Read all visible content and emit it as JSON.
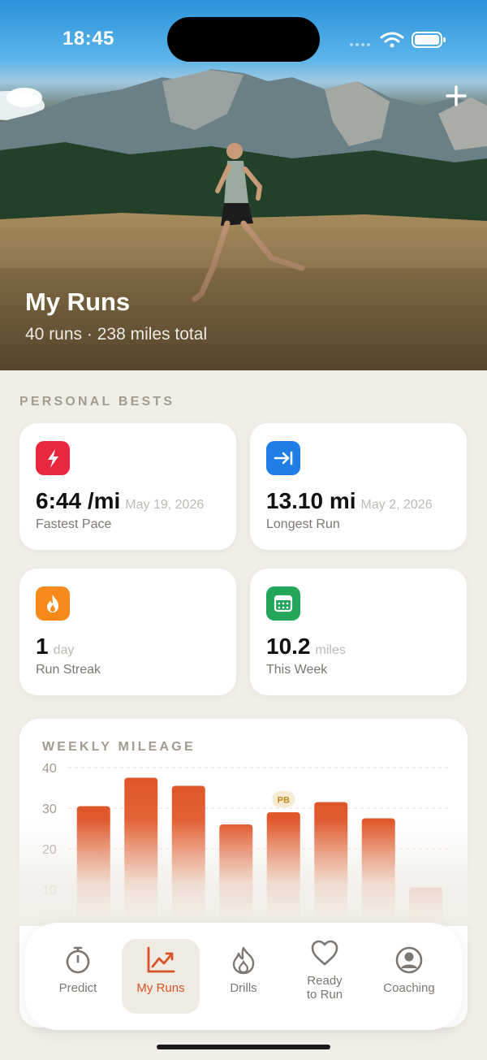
{
  "status_bar": {
    "time": "18:45"
  },
  "hero": {
    "title": "My Runs",
    "subtitle": "40 runs · 238 miles total",
    "add_icon": "plus-icon"
  },
  "personal_bests": {
    "label": "PERSONAL BESTS",
    "cards": [
      {
        "value": "6:44 /mi",
        "aux": "May 19, 2026",
        "label": "Fastest Pace",
        "icon": "lightning-bolt-icon",
        "color": "#E8283F"
      },
      {
        "value": "13.10 mi",
        "aux": "May 2, 2026",
        "label": "Longest Run",
        "icon": "arrow-right-to-line-icon",
        "color": "#1F7EE6"
      },
      {
        "value": "1",
        "aux": "day",
        "label": "Run Streak",
        "icon": "flame-icon",
        "color": "#F58A1A"
      },
      {
        "value": "10.2",
        "aux": "miles",
        "label": "This Week",
        "icon": "calendar-icon",
        "color": "#22A659"
      }
    ]
  },
  "weekly_mileage": {
    "label": "WEEKLY MILEAGE",
    "chart_data": {
      "type": "bar",
      "categories": [
        "",
        "",
        "",
        "",
        "",
        "",
        "",
        ""
      ],
      "values": [
        30.5,
        37.5,
        35.5,
        26,
        29,
        31.5,
        27.5,
        10.5
      ],
      "ylim": [
        0,
        40
      ],
      "yticks": [
        40,
        30,
        20,
        10
      ],
      "highlight_index": 4,
      "highlight_label": "PB",
      "grid": true,
      "bar_color": "#E0552A"
    }
  },
  "tabs": [
    {
      "label": "Predict",
      "icon": "stopwatch-icon",
      "active": false
    },
    {
      "label": "My Runs",
      "icon": "trend-chart-icon",
      "active": true
    },
    {
      "label": "Drills",
      "icon": "flame-icon",
      "active": false
    },
    {
      "label": "Ready to Run",
      "icon": "heart-icon",
      "active": false
    },
    {
      "label": "Coaching",
      "icon": "person-circle-icon",
      "active": false
    }
  ]
}
